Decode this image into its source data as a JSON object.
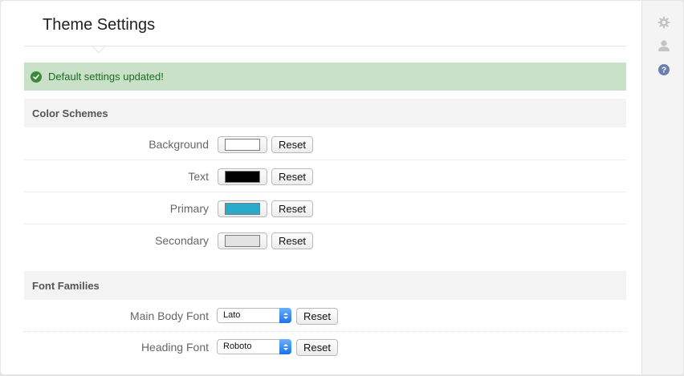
{
  "page": {
    "title": "Theme Settings"
  },
  "alert": {
    "message": "Default settings updated!"
  },
  "color_schemes": {
    "heading": "Color Schemes",
    "rows": [
      {
        "label": "Background",
        "color": "#ffffff",
        "reset_label": "Reset"
      },
      {
        "label": "Text",
        "color": "#000000",
        "reset_label": "Reset"
      },
      {
        "label": "Primary",
        "color": "#2aa9c9",
        "reset_label": "Reset"
      },
      {
        "label": "Secondary",
        "color": "#e3e3e3",
        "reset_label": "Reset"
      }
    ]
  },
  "font_families": {
    "heading": "Font Families",
    "rows": [
      {
        "label": "Main Body Font",
        "value": "Lato",
        "reset_label": "Reset"
      },
      {
        "label": "Heading Font",
        "value": "Roboto",
        "reset_label": "Reset"
      }
    ]
  },
  "sidebar": {
    "icons": [
      {
        "name": "gear-icon",
        "color": "#c4c4c4"
      },
      {
        "name": "user-icon",
        "color": "#c4c4c4"
      },
      {
        "name": "help-icon",
        "color": "#6a7fb0"
      }
    ]
  }
}
